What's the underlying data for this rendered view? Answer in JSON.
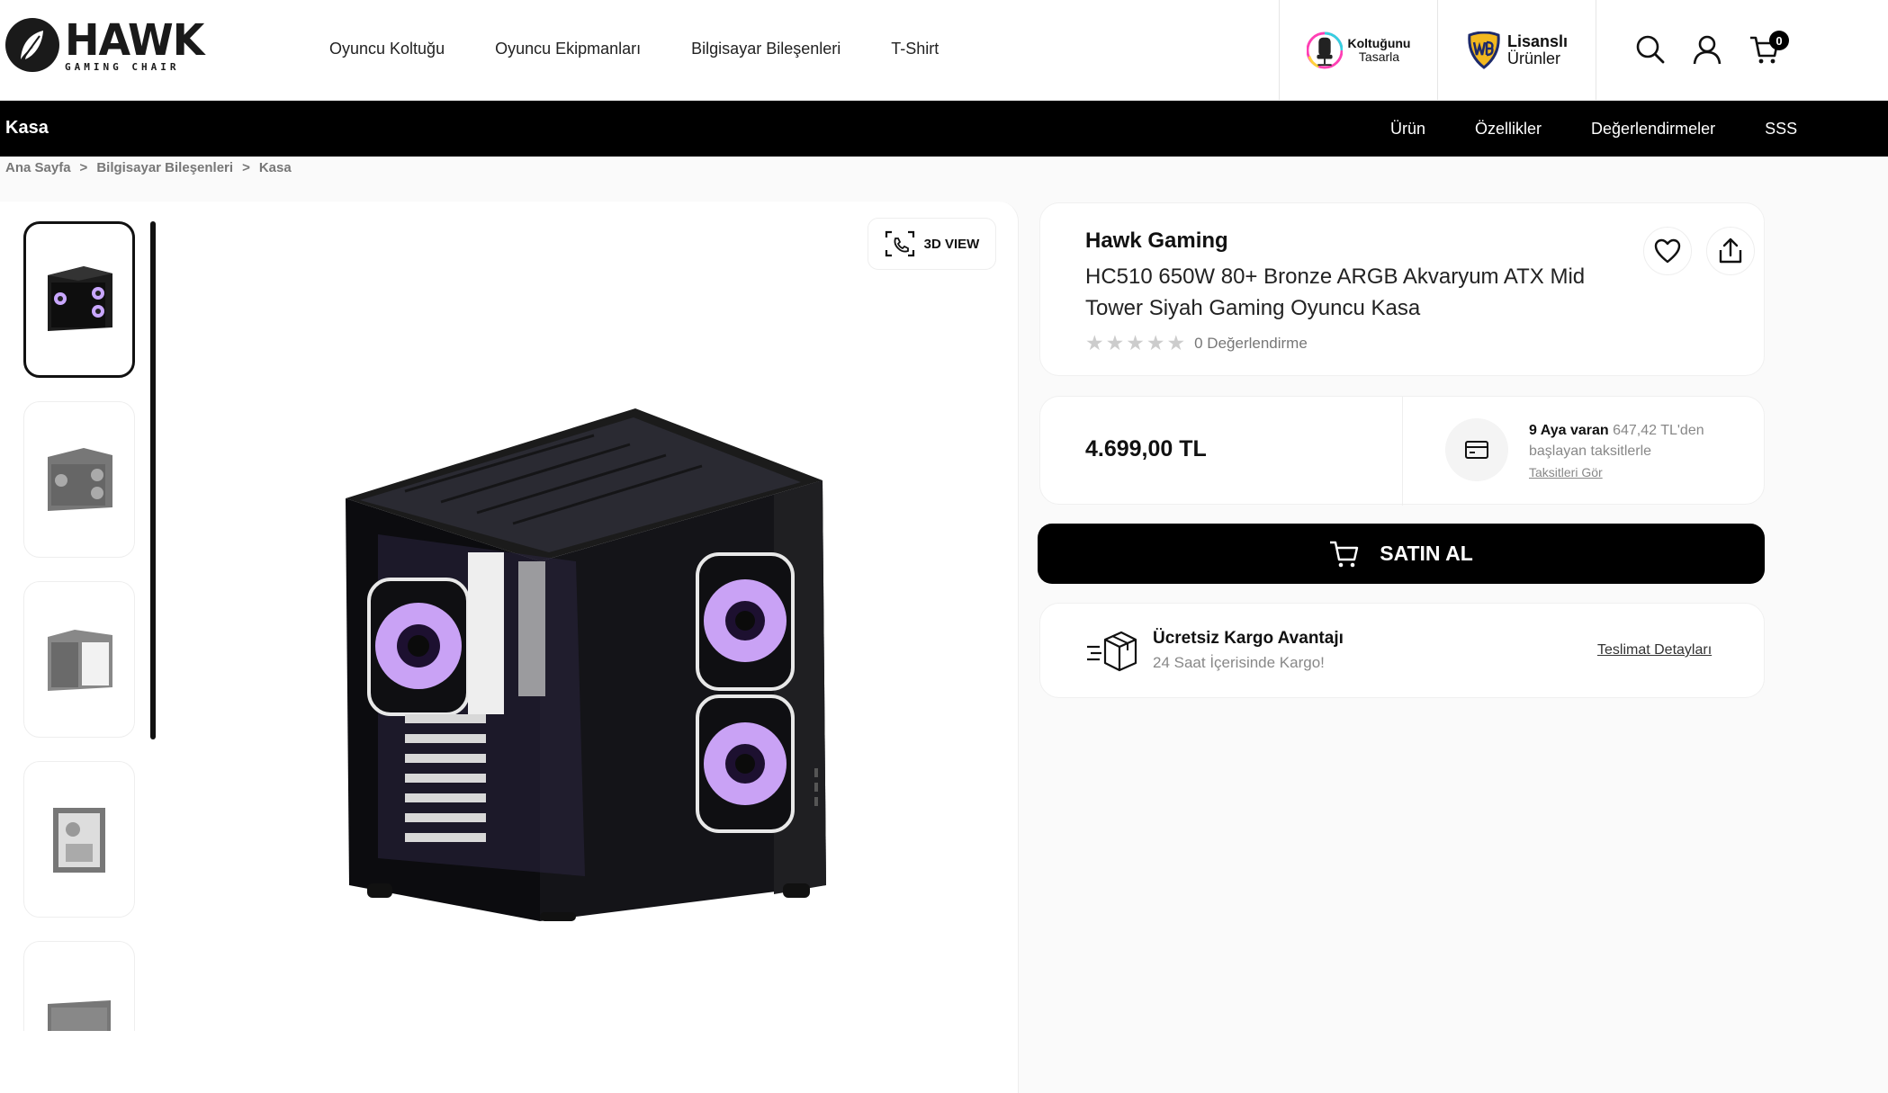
{
  "brand": {
    "logo_text": "HAWK",
    "logo_subtext": "GAMING CHAIR"
  },
  "nav": [
    "Oyuncu Koltuğu",
    "Oyuncu Ekipmanları",
    "Bilgisayar Bileşenleri",
    "T-Shirt"
  ],
  "promos": {
    "design": {
      "line1": "Koltuğunu",
      "line2": "Tasarla"
    },
    "licensed": {
      "line1": "Lisanslı",
      "line2": "Ürünler"
    }
  },
  "header_icons": [
    "search-icon",
    "user-icon",
    "cart-icon"
  ],
  "cart_count": "0",
  "subbar": {
    "title": "Kasa",
    "links": [
      "Ürün",
      "Özellikler",
      "Değerlendirmeler",
      "SSS"
    ]
  },
  "breadcrumb": {
    "items": [
      "Ana Sayfa",
      "Bilgisayar Bileşenleri",
      "Kasa"
    ],
    "separator": ">"
  },
  "gallery": {
    "view3d_label": "3D VIEW",
    "thumb_count": 5,
    "active_thumb": 0
  },
  "product": {
    "brand": "Hawk Gaming",
    "title": "HC510 650W 80+ Bronze ARGB Akvaryum ATX Mid Tower Siyah Gaming Oyuncu Kasa",
    "rating_stars": 0,
    "rating_text": "0 Değerlendirme",
    "price": "4.699,00 TL",
    "installment": {
      "months": "9 Aya varan",
      "amount": "647,42 TL'den",
      "suffix": "başlayan taksitlerle",
      "link": "Taksitleri Gör"
    },
    "buy_label": "SATIN AL",
    "shipping": {
      "title": "Ücretsiz Kargo Avantajı",
      "subtitle": "24 Saat İçerisinde Kargo!",
      "link": "Teslimat Detayları"
    }
  },
  "colors": {
    "accent": "#000000",
    "text_muted": "#888888",
    "background": "#fafafa"
  }
}
